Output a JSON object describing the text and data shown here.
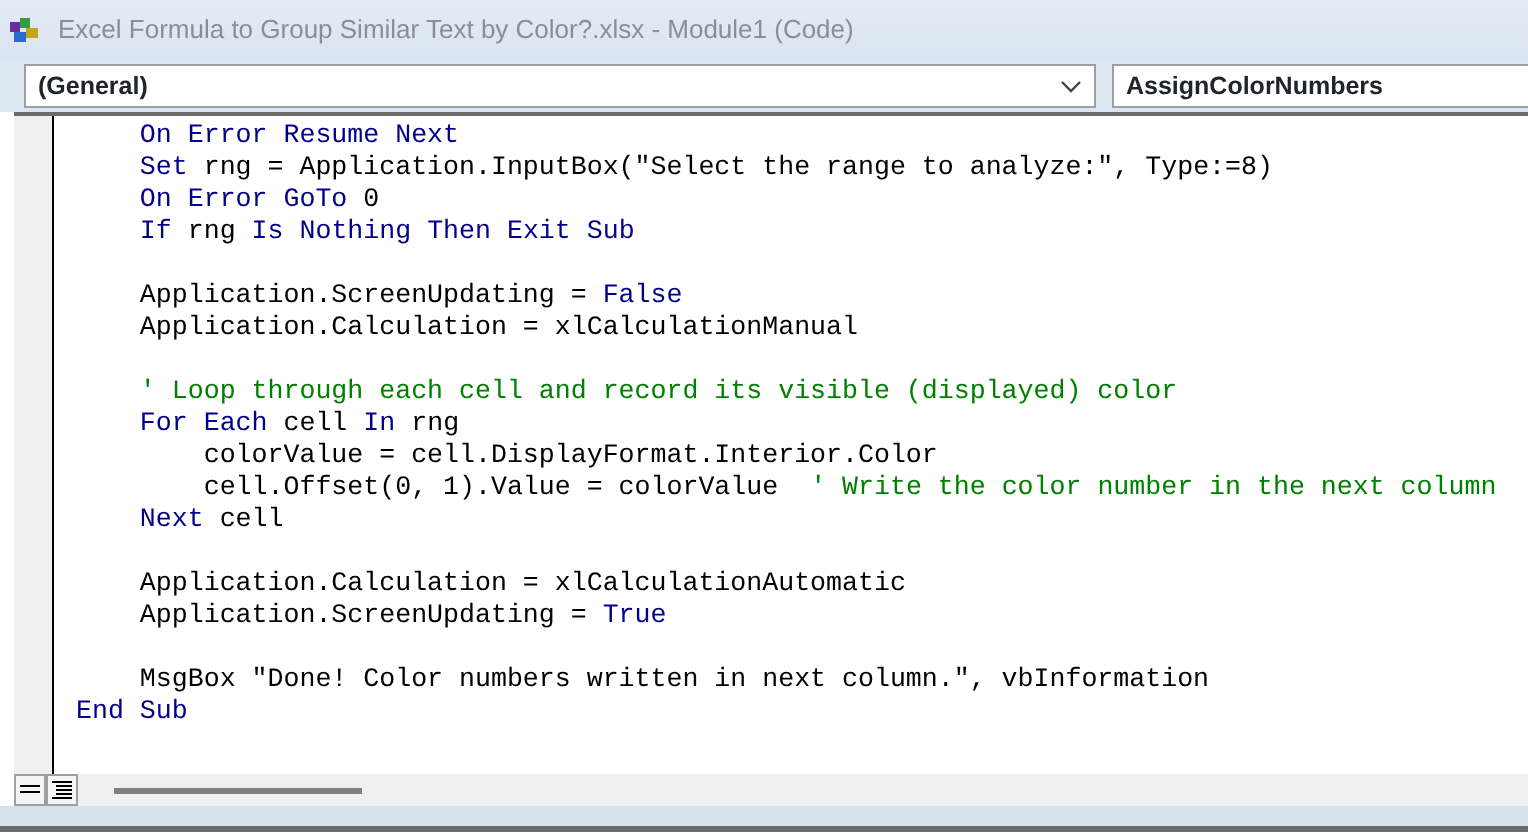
{
  "window": {
    "title": "Excel Formula to Group Similar Text by Color?.xlsx - Module1 (Code)"
  },
  "object_dropdown": {
    "value": "(General)"
  },
  "procedure_dropdown": {
    "value": "AssignColorNumbers"
  },
  "code_lines": [
    {
      "kind": "code",
      "segments": [
        {
          "kind": "keyword",
          "text": "    On Error Resume Next"
        }
      ]
    },
    {
      "kind": "code",
      "segments": [
        {
          "kind": "keyword",
          "text": "    Set"
        },
        {
          "kind": "plain",
          "text": " rng = Application.InputBox(\"Select the range to analyze:\", Type:=8)"
        }
      ]
    },
    {
      "kind": "code",
      "segments": [
        {
          "kind": "keyword",
          "text": "    On Error GoTo"
        },
        {
          "kind": "plain",
          "text": " 0"
        }
      ]
    },
    {
      "kind": "code",
      "segments": [
        {
          "kind": "keyword",
          "text": "    If"
        },
        {
          "kind": "plain",
          "text": " rng "
        },
        {
          "kind": "keyword",
          "text": "Is Nothing Then Exit Sub"
        }
      ]
    },
    {
      "kind": "blank"
    },
    {
      "kind": "code",
      "segments": [
        {
          "kind": "plain",
          "text": "    Application.ScreenUpdating = "
        },
        {
          "kind": "keyword",
          "text": "False"
        }
      ]
    },
    {
      "kind": "code",
      "segments": [
        {
          "kind": "plain",
          "text": "    Application.Calculation = xlCalculationManual"
        }
      ]
    },
    {
      "kind": "blank"
    },
    {
      "kind": "code",
      "segments": [
        {
          "kind": "comment",
          "text": "    ' Loop through each cell and record its visible (displayed) color"
        }
      ]
    },
    {
      "kind": "code",
      "segments": [
        {
          "kind": "keyword",
          "text": "    For Each"
        },
        {
          "kind": "plain",
          "text": " cell "
        },
        {
          "kind": "keyword",
          "text": "In"
        },
        {
          "kind": "plain",
          "text": " rng"
        }
      ]
    },
    {
      "kind": "code",
      "segments": [
        {
          "kind": "plain",
          "text": "        colorValue = cell.DisplayFormat.Interior.Color"
        }
      ]
    },
    {
      "kind": "code",
      "segments": [
        {
          "kind": "plain",
          "text": "        cell.Offset(0, 1).Value = colorValue  "
        },
        {
          "kind": "comment",
          "text": "' Write the color number in the next column"
        }
      ]
    },
    {
      "kind": "code",
      "segments": [
        {
          "kind": "keyword",
          "text": "    Next"
        },
        {
          "kind": "plain",
          "text": " cell"
        }
      ]
    },
    {
      "kind": "blank"
    },
    {
      "kind": "code",
      "segments": [
        {
          "kind": "plain",
          "text": "    Application.Calculation = xlCalculationAutomatic"
        }
      ]
    },
    {
      "kind": "code",
      "segments": [
        {
          "kind": "plain",
          "text": "    Application.ScreenUpdating = "
        },
        {
          "kind": "keyword",
          "text": "True"
        }
      ]
    },
    {
      "kind": "blank"
    },
    {
      "kind": "code",
      "segments": [
        {
          "kind": "plain",
          "text": "    MsgBox \"Done! Color numbers written in next column.\", vbInformation"
        }
      ]
    },
    {
      "kind": "code",
      "segments": [
        {
          "kind": "keyword",
          "text": "End Sub"
        }
      ]
    }
  ]
}
